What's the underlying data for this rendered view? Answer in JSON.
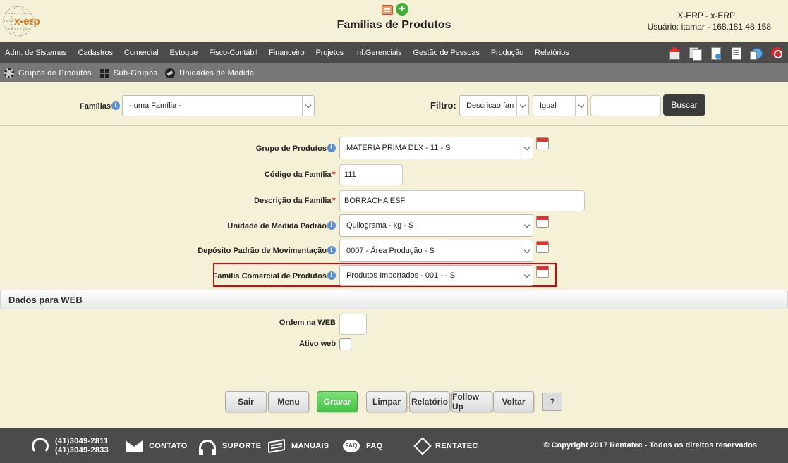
{
  "header": {
    "logo_text": "x-erp",
    "page_title": "Famílias de Produtos",
    "system_name": "X-ERP - x-ERP",
    "user_info": "Usuário: itamar - 168.181.48.158"
  },
  "menu": {
    "items": [
      "Adm. de Sistemas",
      "Cadastros",
      "Comercial",
      "Estoque",
      "Fisco-Contábil",
      "Financeiro",
      "Projetos",
      "Inf.Gerenciais",
      "Gestão de Pessoas",
      "Produção",
      "Relatórios"
    ],
    "toolbar_icons": [
      "home-icon",
      "pages-icon",
      "document-icon",
      "list-icon",
      "network-icon",
      "power-icon"
    ]
  },
  "submenu": {
    "items": [
      {
        "label": "Grupos de Produtos",
        "icon": "gear-icon"
      },
      {
        "label": "Sub-Grupos",
        "icon": "grid-icon"
      },
      {
        "label": "Unidades de Medida",
        "icon": "ruler-icon"
      }
    ]
  },
  "filter": {
    "familias_label": "Famílias",
    "familias_value": "- uma Família -",
    "filtro_label": "Filtro:",
    "field_value": "Descricao fan",
    "operator_value": "Igual",
    "search_value": "",
    "search_button": "Buscar"
  },
  "form": {
    "grupo_label": "Grupo de Produtos",
    "grupo_value": "MATERIA PRIMA DLX - 11 - S",
    "codigo_label": "Código da Família",
    "codigo_value": "111",
    "descricao_label": "Descrição da Família",
    "descricao_value": "BORRACHA ESF",
    "unidade_label": "Unidade de Medida Padrão",
    "unidade_value": "Quilograma - kg - S",
    "deposito_label": "Depósito Padrão de Movimentação",
    "deposito_value": "0007 - Área Produção - S",
    "familia_comercial_label": "Família Comercial de Produtos",
    "familia_comercial_value": "Produtos Importados - 001 - - S",
    "required_mark": "*",
    "info_mark": "i"
  },
  "web_section": {
    "title": "Dados para WEB",
    "ordem_label": "Ordem na WEB",
    "ordem_value": "",
    "ativo_label": "Ativo web",
    "ativo_checked": false
  },
  "actions": {
    "sair": "Sair",
    "menu": "Menu",
    "gravar": "Gravar",
    "limpar": "Limpar",
    "relatorio": "Relatório",
    "follow_up": "Follow Up",
    "voltar": "Voltar",
    "help": "?"
  },
  "footer": {
    "phone1": "(41)3049-2811",
    "phone2": "(41)3049-2833",
    "contato": "CONTATO",
    "suporte": "SUPORTE",
    "manuais": "MANUAIS",
    "faq": "FAQ",
    "faq_icon_text": "FAQ",
    "rentatec": "RENTATEC",
    "copyright": "© Copyright 2017 Rentatec - Todos os direitos reservados"
  },
  "colors": {
    "background": "#f5f1d6",
    "menubar": "#4b4b4b",
    "submenu": "#777777",
    "highlight_border": "#e00000",
    "save_button": "#46c445"
  }
}
